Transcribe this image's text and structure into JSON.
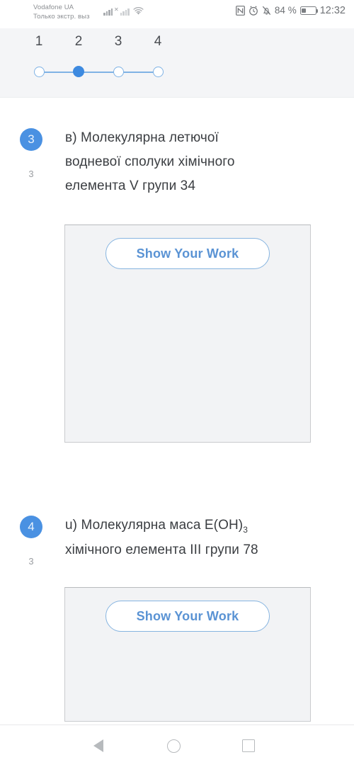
{
  "status_bar": {
    "carrier_line1": "Vodafone UA",
    "carrier_line2": "Только экстр. выз",
    "nfc_icon": "nfc-icon",
    "alarm_icon": "alarm-clock-icon",
    "mute_icon": "bell-muted-icon",
    "battery_percent": "84 %",
    "time": "12:32",
    "signal_icon": "cellular-signal-icon",
    "signal_icon_secondary": "cellular-signal-no-service-icon",
    "wifi_icon": "wifi-icon"
  },
  "stepper": {
    "steps": [
      {
        "label": "1",
        "state": "done"
      },
      {
        "label": "2",
        "state": "active"
      },
      {
        "label": "3",
        "state": "todo"
      },
      {
        "label": "4",
        "state": "todo"
      }
    ],
    "accent_color": "#3d8ae0",
    "track_color": "#7fb2e5"
  },
  "questions": [
    {
      "number": "3",
      "points": "3",
      "text_line1": "в) Молекулярна летючої",
      "text_line2": "водневої сполуки хімічного",
      "text_line3": "елемента V групи 34",
      "show_work_label": "Show Your Work"
    },
    {
      "number": "4",
      "points": "3",
      "text_line1_a": "u) Молекулярна маса E(OH)",
      "text_line1_sub": "3",
      "text_line2": "хімічного елемента III групи 78",
      "show_work_label": "Show Your Work"
    }
  ],
  "nav_bar": {
    "back_icon": "back-triangle-icon",
    "home_icon": "home-circle-icon",
    "recents_icon": "recents-square-icon"
  },
  "colors": {
    "badge_blue": "#4a91e2",
    "button_blue": "#5a93d4",
    "button_border": "#86b4e0",
    "answer_box_fill": "#f2f3f5",
    "header_band": "#f4f5f7",
    "text_dark": "#3b3e42",
    "text_muted": "#9b9ea2"
  }
}
